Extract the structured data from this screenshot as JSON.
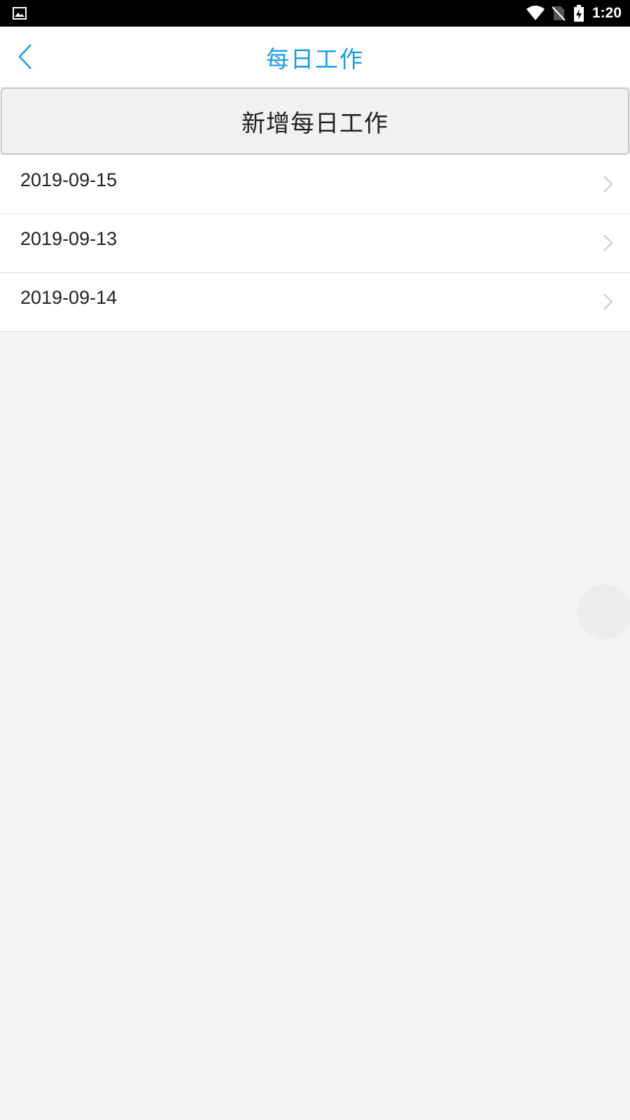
{
  "status_bar": {
    "time": "1:20",
    "icons": [
      "gallery-icon",
      "wifi-icon",
      "no-sim-icon",
      "battery-charging-icon"
    ]
  },
  "header": {
    "title": "每日工作",
    "back_icon": "chevron-left-icon",
    "accent_color": "#1a9ee0"
  },
  "actions": {
    "add_label": "新增每日工作"
  },
  "list": {
    "items": [
      {
        "date": "2019-09-15"
      },
      {
        "date": "2019-09-13"
      },
      {
        "date": "2019-09-14"
      }
    ],
    "row_icon": "chevron-right-icon"
  }
}
